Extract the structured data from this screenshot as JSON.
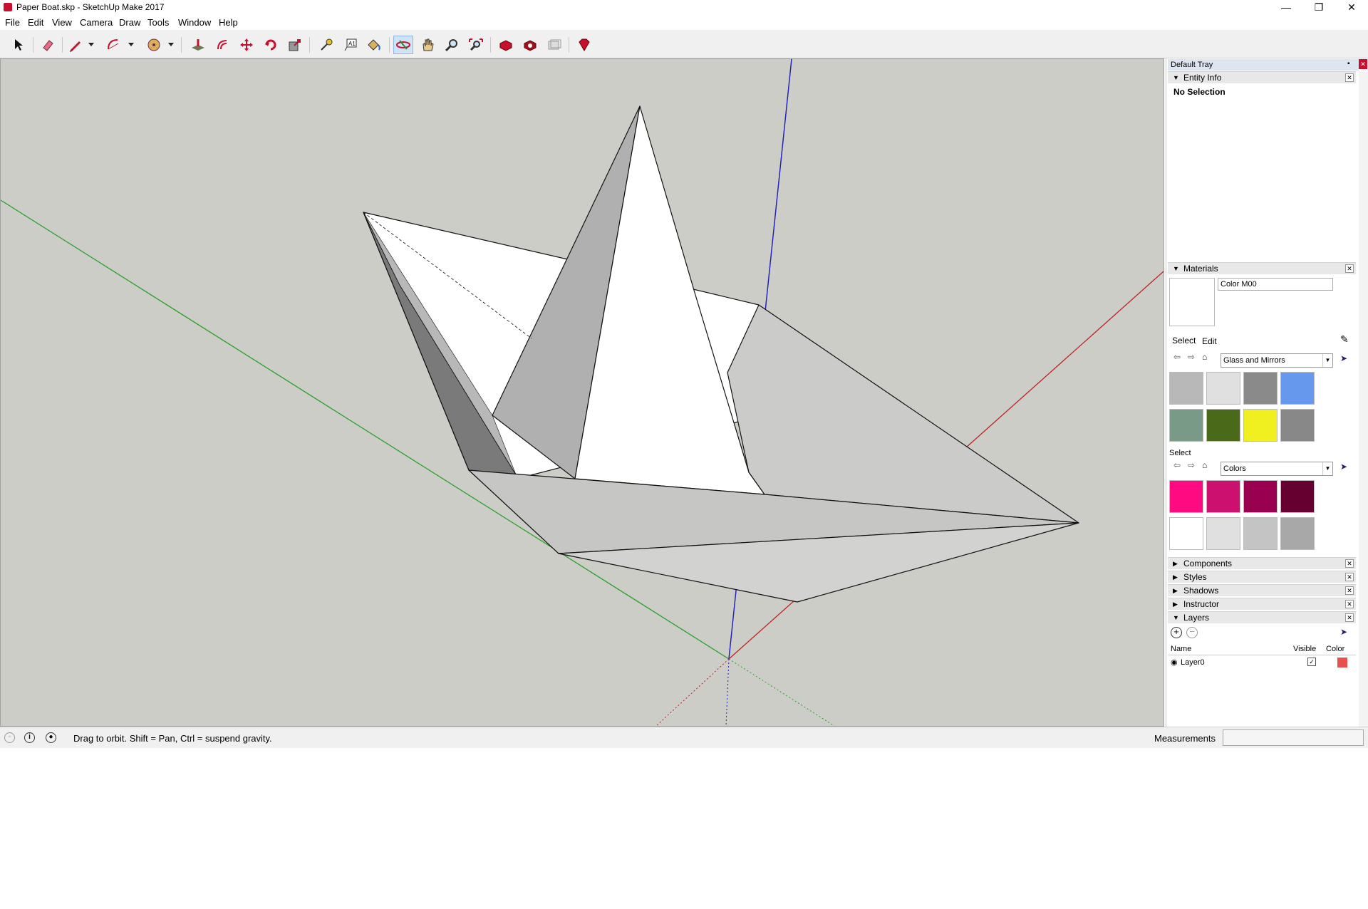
{
  "window": {
    "title": "Paper Boat.skp - SketchUp Make 2017"
  },
  "menu": [
    "File",
    "Edit",
    "View",
    "Camera",
    "Draw",
    "Tools",
    "Window",
    "Help"
  ],
  "toolbar": {
    "tools": [
      "select-tool",
      "eraser-tool",
      "line-tool",
      "arc-tool",
      "shapes-tool",
      "push-pull-tool",
      "offset-tool",
      "move-tool",
      "rotate-tool",
      "scale-tool",
      "tape-measure-tool",
      "text-tool",
      "paint-bucket-tool",
      "orbit-tool",
      "pan-tool",
      "zoom-tool",
      "zoom-extents-tool",
      "warehouse-tool",
      "extension-warehouse-tool",
      "layout-tool",
      "extension-manager-tool"
    ],
    "active_tool": "orbit-tool",
    "accent": "#c8102e"
  },
  "tray": {
    "title": "Default Tray",
    "entity_info": {
      "header": "Entity Info",
      "selection": "No Selection"
    },
    "materials": {
      "header": "Materials",
      "material_name": "Color M00",
      "tabs": [
        "Select",
        "Edit"
      ],
      "library1": "Glass and Mirrors",
      "library2_label": "Select",
      "library2": "Colors",
      "glass_swatches": [
        "#b8b8b8",
        "#e0e0e0",
        "#8a8a8a",
        "#6699ee",
        "#7a9a88",
        "#4a6a1a",
        "#f0f020",
        "#888888"
      ],
      "color_swatches": [
        "#ff0a80",
        "#cc1070",
        "#990050",
        "#660030",
        "#ffffff",
        "#e0e0e0",
        "#c4c4c4",
        "#a8a8a8"
      ]
    },
    "collapsed_panels": [
      "Components",
      "Styles",
      "Shadows",
      "Instructor"
    ],
    "layers": {
      "header": "Layers",
      "columns": [
        "Name",
        "Visible",
        "Color"
      ],
      "rows": [
        {
          "name": "Layer0",
          "visible": true,
          "color": "#e85050"
        }
      ]
    }
  },
  "status": {
    "message": "Drag to orbit. Shift = Pan, Ctrl = suspend gravity.",
    "measurements_label": "Measurements"
  }
}
